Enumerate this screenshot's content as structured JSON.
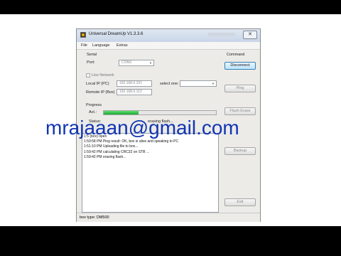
{
  "window": {
    "title": "Universal DreamUp V1.3.3.6",
    "close_glyph": "✕",
    "menu": [
      "File",
      "Language",
      "Extras"
    ]
  },
  "serial": {
    "group_label": "Serial",
    "port_label": "Port:",
    "port_value": "COM1"
  },
  "network": {
    "use_network_label": "Use Network",
    "local_ip_label": "Local IP (PC)",
    "local_ip_value": "192.168.0.101",
    "select_one_label": "select one:",
    "remote_ip_label": "Remote IP (Box)",
    "remote_ip_value": "192.168.0.113"
  },
  "command": {
    "group_label": "Command",
    "disconnect": "Disconnect",
    "ping": "Ping",
    "flash_erase": "Flash Erase",
    "backup": "Backup",
    "exit": "Exit"
  },
  "progress": {
    "label": "Progress",
    "act_label": "Act.:",
    "fraction": 0.31,
    "status_label": "Status:",
    "status_value": "erasing flash..."
  },
  "log": {
    "lines": [
      "1:5                 (box) open",
      "1:59:58 PM Ping result: OK, box is alive and speaking to PC",
      "1:51:10 PM Uploading file to box...",
      "1:59:42 PM calculating CRC32 on STB ...",
      "1:59:42 PM erasing flash..."
    ]
  },
  "statusbar": {
    "text": "box type: DM500"
  },
  "overlay": {
    "email": "mrajaaan@gmail.com"
  }
}
